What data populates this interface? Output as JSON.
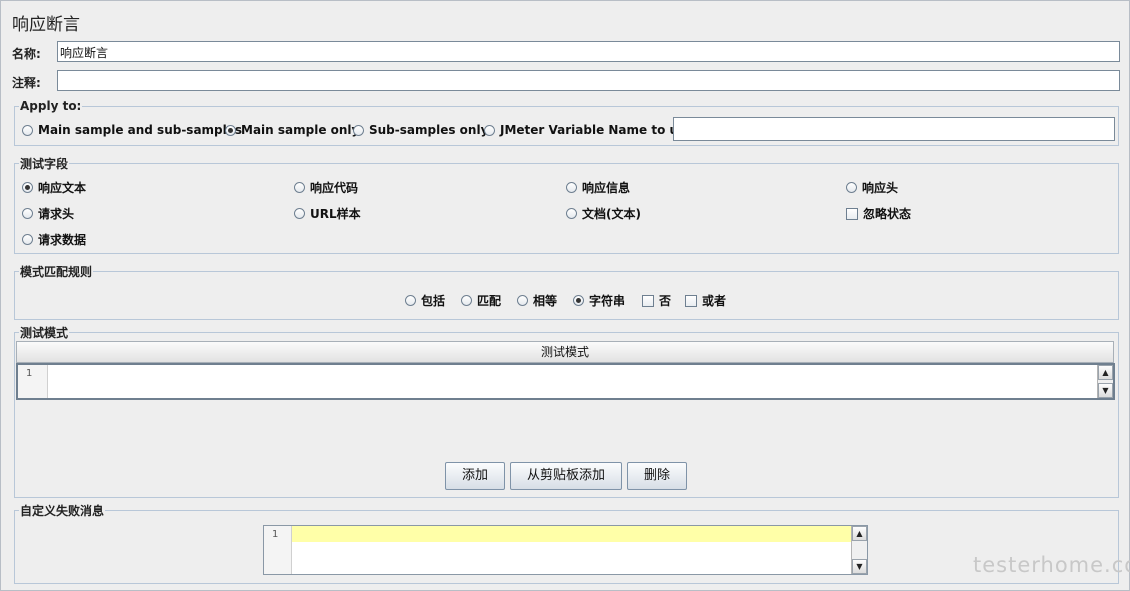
{
  "panel_title": "响应断言",
  "name": {
    "label": "名称:",
    "value": "响应断言"
  },
  "comment": {
    "label": "注释:",
    "value": ""
  },
  "apply_to": {
    "legend": "Apply to:",
    "options": [
      "Main sample and sub-samples",
      "Main sample only",
      "Sub-samples only",
      "JMeter Variable Name to use"
    ],
    "selected": "Main sample only",
    "variable_value": ""
  },
  "test_field": {
    "legend": "测试字段",
    "options": [
      "响应文本",
      "响应代码",
      "响应信息",
      "响应头",
      "请求头",
      "URL样本",
      "文档(文本)",
      "请求数据"
    ],
    "selected": "响应文本",
    "ignore_status": {
      "label": "忽略状态",
      "checked": false
    }
  },
  "pattern_rules": {
    "legend": "模式匹配规则",
    "options": [
      "包括",
      "匹配",
      "相等",
      "字符串"
    ],
    "selected": "字符串",
    "not_label": "否",
    "or_label": "或者"
  },
  "test_patterns": {
    "legend": "测试模式",
    "column_header": "测试模式",
    "line_number": "1",
    "buttons": {
      "add": "添加",
      "add_from_clipboard": "从剪贴板添加",
      "delete": "删除"
    }
  },
  "custom_failure": {
    "legend": "自定义失败消息",
    "line_number": "1",
    "highlight_color": "#ffffa8"
  },
  "watermark": "testerhome.com",
  "icons": {
    "scroll_up": "▲",
    "scroll_down": "▼"
  }
}
